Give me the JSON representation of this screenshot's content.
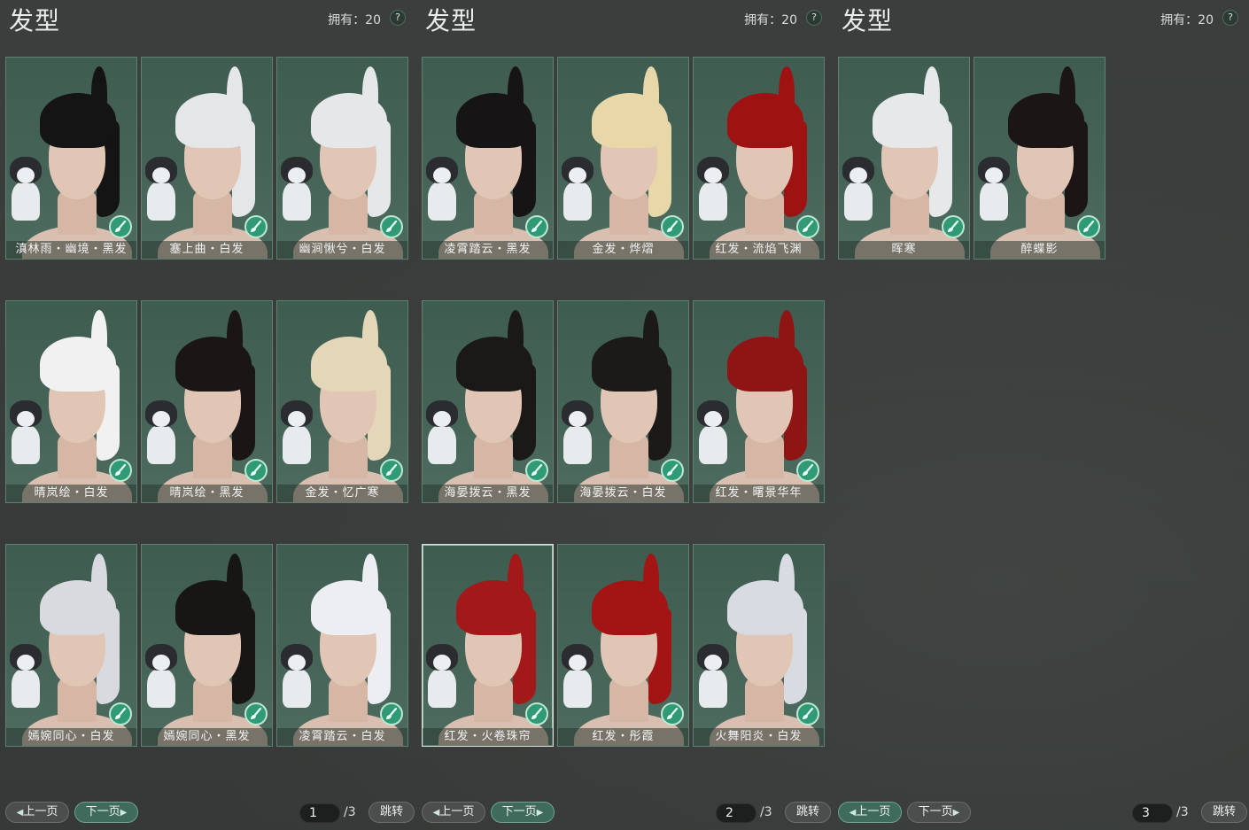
{
  "panels": [
    {
      "title": "发型",
      "owned": "拥有：20",
      "help": "?",
      "page": "1",
      "page_total": "/3",
      "prev": "上一页",
      "next": "下一页",
      "jump": "跳转",
      "items": [
        {
          "label": "滇林雨・幽境・黑发",
          "hair": "#151414"
        },
        {
          "label": "塞上曲・白发",
          "hair": "#e5e6e8"
        },
        {
          "label": "幽涧愀兮・白发",
          "hair": "#e6e7e9"
        },
        {
          "label": "晴岚绘・白发",
          "hair": "#f1f1f1"
        },
        {
          "label": "晴岚绘・黑发",
          "hair": "#1a1616"
        },
        {
          "label": "金发・忆广寒",
          "hair": "#e3d7b8"
        },
        {
          "label": "嫣婉同心・白发",
          "hair": "#d9dadf"
        },
        {
          "label": "嫣婉同心・黑发",
          "hair": "#181515"
        },
        {
          "label": "凌霄踏云・白发",
          "hair": "#eceef1"
        }
      ]
    },
    {
      "title": "发型",
      "owned": "拥有：20",
      "help": "?",
      "page": "2",
      "page_total": "/3",
      "prev": "上一页",
      "next": "下一页",
      "jump": "跳转",
      "items": [
        {
          "label": "凌霄踏云・黑发",
          "hair": "#161414"
        },
        {
          "label": "金发・烨熠",
          "hair": "#e7d7a9"
        },
        {
          "label": "红发・流焰飞渊",
          "hair": "#9e1212"
        },
        {
          "label": "海晏拨云・黑发",
          "hair": "#1b1918"
        },
        {
          "label": "海晏拨云・白发",
          "hair": "#1c1a19"
        },
        {
          "label": "红发・曙景华年",
          "hair": "#8f1515"
        },
        {
          "label": "红发・火卷珠帘",
          "hair": "#a31818",
          "selected": true
        },
        {
          "label": "红发・彤霞",
          "hair": "#a31414"
        },
        {
          "label": "火舞阳炎・白发",
          "hair": "#d8dbe2"
        }
      ]
    },
    {
      "title": "发型",
      "owned": "拥有：20",
      "help": "?",
      "page": "3",
      "page_total": "/3",
      "prev": "上一页",
      "next": "下一页",
      "jump": "跳转",
      "items": [
        {
          "label": "晖寒",
          "hair": "#e7e8ea"
        },
        {
          "label": "醉蝶影",
          "hair": "#1b1515"
        }
      ]
    }
  ],
  "icons": {
    "dye": "dye-brush-icon",
    "pet": "husky-pet-icon"
  }
}
